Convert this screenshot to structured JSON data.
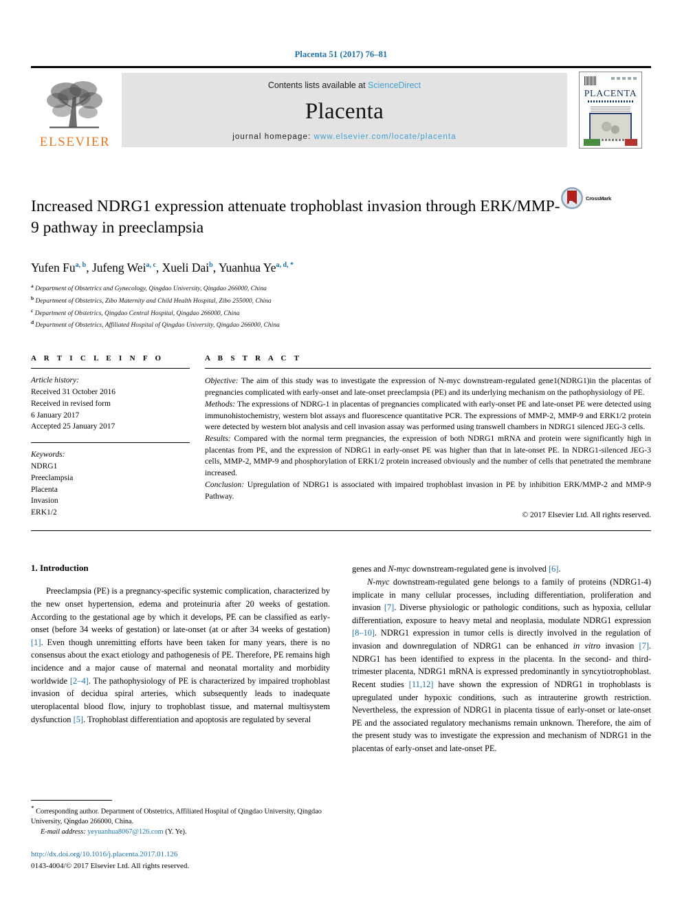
{
  "running_head": "Placenta 51 (2017) 76–81",
  "banner": {
    "publisher_logo_text": "ELSEVIER",
    "contents_prefix": "Contents lists available at ",
    "contents_link": "ScienceDirect",
    "journal_name": "Placenta",
    "homepage_prefix": "journal homepage: ",
    "homepage_url": "www.elsevier.com/locate/placenta",
    "cover_title": "PLACENTA"
  },
  "article": {
    "title": "Increased NDRG1 expression attenuate trophoblast invasion through ERK/MMP-9 pathway in preeclampsia",
    "crossmark_label": "CrossMark",
    "authors": [
      {
        "name": "Yufen Fu",
        "marks": "a, b",
        "sep": ", "
      },
      {
        "name": "Jufeng Wei",
        "marks": "a, c",
        "sep": ", "
      },
      {
        "name": "Xueli Dai",
        "marks": "b",
        "sep": ", "
      },
      {
        "name": "Yuanhua Ye",
        "marks": "a, d, *",
        "sep": ""
      }
    ],
    "affiliations": [
      {
        "mark": "a",
        "text": "Department of Obstetrics and Gynecology, Qingdao University, Qingdao 266000, China"
      },
      {
        "mark": "b",
        "text": "Department of Obstetrics, Zibo Maternity and Child Health Hospital, Zibo 255000, China"
      },
      {
        "mark": "c",
        "text": "Department of Obstetrics, Qingdao Central Hospital, Qingdao 266000, China"
      },
      {
        "mark": "d",
        "text": "Department of Obstetrics, Affiliated Hospital of Qingdao University, Qingdao 266000, China"
      }
    ]
  },
  "article_info": {
    "heading": "A R T I C L E   I N F O",
    "history_label": "Article history:",
    "history_lines": [
      "Received 31 October 2016",
      "Received in revised form",
      "6 January 2017",
      "Accepted 25 January 2017"
    ],
    "keywords_label": "Keywords:",
    "keywords": [
      "NDRG1",
      "Preeclampsia",
      "Placenta",
      "Invasion",
      "ERK1/2"
    ]
  },
  "abstract": {
    "heading": "A B S T R A C T",
    "objective_label": "Objective:",
    "objective_text": " The aim of this study was to investigate the expression of N-myc downstream-regulated gene1(NDRG1)in the placentas of pregnancies complicated with early-onset and late-onset preeclampsia (PE) and its underlying mechanism on the pathophysiology of PE.",
    "methods_label": "Methods:",
    "methods_text": " The expressions of NDRG-1 in placentas of pregnancies complicated with early-onset PE and late-onset PE were detected using immunohistochemistry, western blot assays and fluorescence quantitative PCR. The expressions of MMP-2, MMP-9 and ERK1/2 protein were detected by western blot analysis and cell invasion assay was performed using transwell chambers in NDRG1 silenced JEG-3 cells.",
    "results_label": "Results:",
    "results_text": " Compared with the normal term pregnancies, the expression of both NDRG1 mRNA and protein were significantly high in placentas from PE, and the expression of NDRG1 in early-onset PE was higher than that in late-onset PE. In NDRG1-silenced JEG-3 cells, MMP-2, MMP-9 and phosphorylation of ERK1/2 protein increased obviously and the number of cells that penetrated the membrane increased.",
    "conclusion_label": "Conclusion:",
    "conclusion_text": " Upregulation of NDRG1 is associated with impaired trophoblast invasion in PE by inhibition ERK/MMP-2 and MMP-9 Pathway.",
    "copyright": "© 2017 Elsevier Ltd. All rights reserved."
  },
  "introduction": {
    "heading": "1. Introduction",
    "left_paragraph_1": "Preeclampsia (PE) is a pregnancy-specific systemic complication, characterized by the new onset hypertension, edema and proteinuria after 20 weeks of gestation. According to the gestational age by which it develops, PE can be classified as early-onset (before 34 weeks of gestation) or late-onset (at or after 34 weeks of gestation) ",
    "ref_1": "[1]",
    "left_paragraph_1b": ". Even though unremitting efforts have been taken for many years, there is no consensus about the exact etiology and pathogenesis of PE. Therefore, PE remains high incidence and a major cause of maternal and neonatal mortality and morbidity worldwide ",
    "ref_2": "[2–4]",
    "left_paragraph_1c": ". The pathophysiology of PE is characterized by impaired trophoblast invasion of decidua spiral arteries, which subsequently leads to inadequate uteroplacental blood flow, injury to trophoblast tissue, and maternal multisystem dysfunction ",
    "ref_5": "[5]",
    "left_paragraph_1d": ". Trophoblast differentiation and apoptosis are regulated by several",
    "right_cont_text": "genes and ",
    "right_cont_italic": "N-myc",
    "right_cont_text2": " downstream-regulated gene is involved ",
    "ref_6": "[6]",
    "right_cont_text3": ".",
    "right_p2_italic": "N-myc",
    "right_p2_a": " downstream-regulated gene belongs to a family of proteins (NDRG1-4) implicate in many cellular processes, including differentiation, proliferation and invasion ",
    "ref_7a": "[7]",
    "right_p2_b": ". Diverse physiologic or pathologic conditions, such as hypoxia, cellular differentiation, exposure to heavy metal and neoplasia, modulate NDRG1 expression ",
    "ref_8": "[8–10]",
    "right_p2_c": ". NDRG1 expression in tumor cells is directly involved in the regulation of invasion and downregulation of NDRG1 can be enhanced ",
    "right_p2_invitro": "in vitro",
    "right_p2_d": " invasion ",
    "ref_7b": "[7]",
    "right_p2_e": ". NDRG1 has been identified to express in the placenta. In the second- and third-trimester placenta, NDRG1 mRNA is expressed predominantly in syncytiotrophoblast. Recent studies ",
    "ref_11": "[11,12]",
    "right_p2_f": " have shown the expression of NDRG1 in trophoblasts is upregulated under hypoxic conditions, such as intrauterine growth restriction. Nevertheless, the expression of NDRG1 in placenta tissue of early-onset or late-onset PE and the associated regulatory mechanisms remain unknown. Therefore, the aim of the present study was to investigate the expression and mechanism of NDRG1 in the placentas of early-onset and late-onset PE."
  },
  "footnotes": {
    "corresponding_star": "*",
    "corresponding_text": " Corresponding author. Department of Obstetrics, Affiliated Hospital of Qingdao University, Qingdao University, Qingdao 266000, China.",
    "email_label": "E-mail address:",
    "email_value": "yeyuanhua8067@126.com",
    "email_suffix": " (Y. Ye).",
    "doi_url": "http://dx.doi.org/10.1016/j.placenta.2017.01.126",
    "issn_line": "0143-4004/© 2017 Elsevier Ltd. All rights reserved."
  },
  "colors": {
    "link_blue": "#1a6fa8",
    "sciencedirect_blue": "#3f9fd0",
    "elsevier_orange": "#E87722",
    "banner_grey": "#e3e3e3"
  }
}
